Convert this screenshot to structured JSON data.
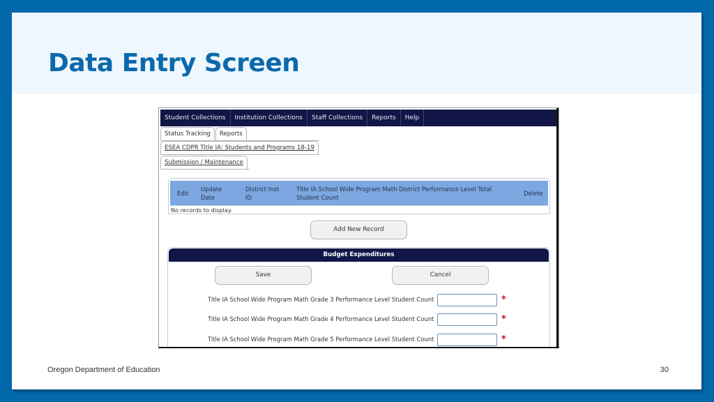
{
  "slide": {
    "title": "Data Entry Screen",
    "footer_org": "Oregon Department of Education",
    "page_number": "30"
  },
  "app": {
    "top_nav": [
      "Student Collections",
      "Institution Collections",
      "Staff Collections",
      "Reports",
      "Help"
    ],
    "tabs_row1": [
      "Status Tracking",
      "Reports"
    ],
    "tabs_row2": [
      "ESEA CDPR Title IA: Students and Programs 18-19"
    ],
    "tabs_row3": [
      "Submission / Maintenance"
    ],
    "grid": {
      "columns": {
        "edit": "Edit",
        "update_date_1": "Update",
        "update_date_2": "Date",
        "district_inst_1": "District Inst",
        "district_inst_2": "ID",
        "count_1": "Title IA School Wide Program Math District Performance Level Total",
        "count_2": "Student Count",
        "delete": "Delete"
      },
      "empty_message": "No records to display."
    },
    "add_button": "Add New Record",
    "panel": {
      "title": "Budget Expenditures",
      "save_button": "Save",
      "cancel_button": "Cancel",
      "fields": [
        {
          "label": "Title IA School Wide Program Math Grade 3 Performance Level Student Count",
          "value": "",
          "required": "*"
        },
        {
          "label": "Title IA School Wide Program Math Grade 4 Performance Level Student Count",
          "value": "",
          "required": "*"
        },
        {
          "label": "Title IA School Wide Program Math Grade 5 Performance Level Student Count",
          "value": "",
          "required": "*"
        }
      ]
    }
  },
  "colors": {
    "frame": "#0268ac",
    "title": "#0a69ab",
    "nav": "#121646",
    "grid_header": "#7da7e0",
    "required": "#c8102e"
  }
}
